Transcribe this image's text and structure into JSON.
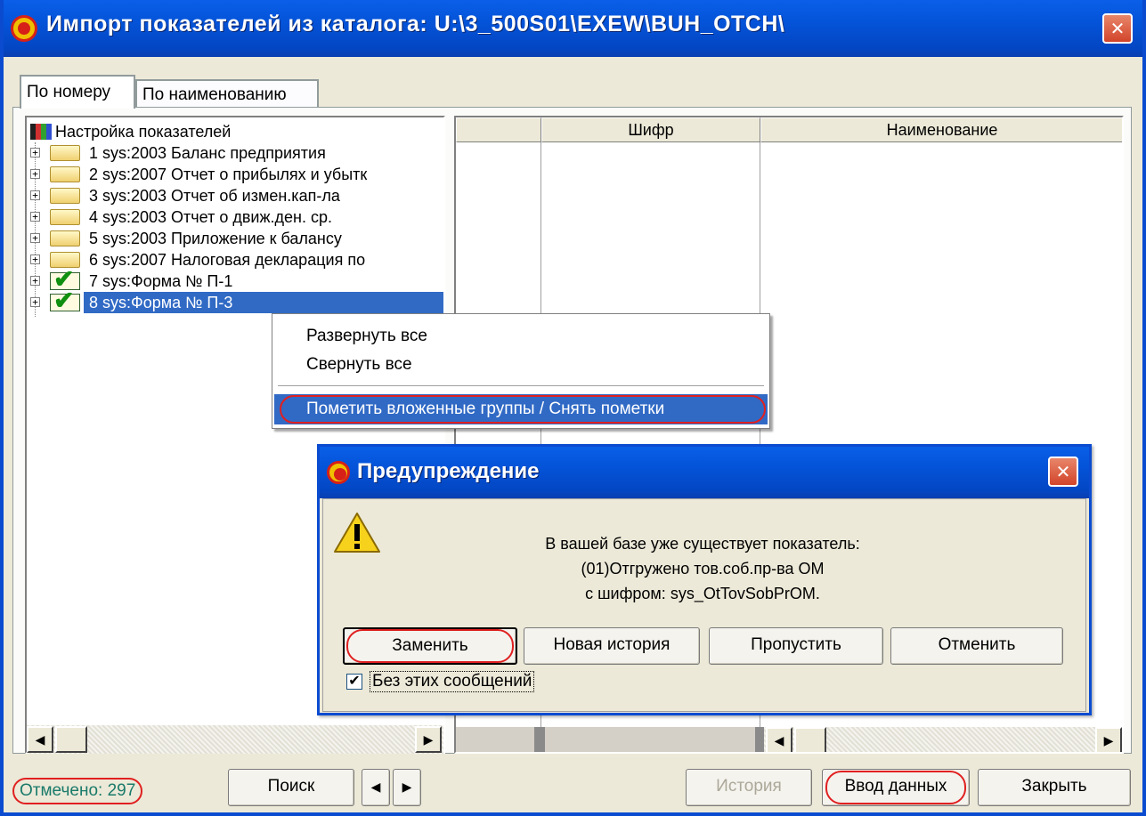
{
  "window": {
    "title": "Импорт показателей из каталога:  U:\\3_500S01\\EXEW\\BUH_OTCH\\",
    "close_label": "✕"
  },
  "tabs": [
    {
      "label": "По номеру",
      "active": true
    },
    {
      "label": "По наименованию",
      "active": false
    }
  ],
  "tree": {
    "root_label": "Настройка показателей",
    "items": [
      {
        "label": "1  sys:2003 Баланс предприятия",
        "icon": "folder-icon"
      },
      {
        "label": "2  sys:2007 Отчет о прибылях и убытк",
        "icon": "folder-icon"
      },
      {
        "label": "3  sys:2003 Отчет об измен.кап-ла",
        "icon": "folder-icon"
      },
      {
        "label": "4  sys:2003 Отчет о движ.ден. ср.",
        "icon": "folder-icon"
      },
      {
        "label": "5  sys:2003 Приложение к балансу",
        "icon": "folder-icon"
      },
      {
        "label": "6  sys:2007 Налоговая декларация по",
        "icon": "folder-icon"
      },
      {
        "label": "7  sys:Форма № П-1",
        "icon": "checkmark-icon"
      },
      {
        "label": "8  sys:Форма № П-3",
        "icon": "checkmark-icon",
        "selected": true
      }
    ]
  },
  "grid": {
    "columns": [
      "",
      "Шифр",
      "Наименование"
    ]
  },
  "context_menu": {
    "items": [
      {
        "label": "Развернуть все"
      },
      {
        "label": "Свернуть все"
      },
      {
        "label": "Пометить вложенные группы / Снять пометки",
        "highlighted": true
      }
    ]
  },
  "dialog": {
    "title": "Предупреждение",
    "close_label": "✕",
    "message_lines": [
      "В вашей базе уже существует показатель:",
      "(01)Отгружено тов.соб.пр-ва ОМ",
      "с шифром: sys_OtTovSobPrOM."
    ],
    "buttons": {
      "replace": "Заменить",
      "new_history": "Новая история",
      "skip": "Пропустить",
      "cancel": "Отменить"
    },
    "checkbox_label": "Без этих сообщений",
    "checkbox_checked": true,
    "checkbox_mark": "✔"
  },
  "footer": {
    "marked": "Отмечено: 297",
    "search": "Поиск",
    "prev": "◀",
    "next": "▶",
    "history": "История",
    "data_entry": "Ввод данных",
    "close": "Закрыть"
  },
  "colors": {
    "titlebar": "#0453d8",
    "selection": "#316ac5",
    "annotation_red": "#e02020",
    "counter_text": "#1a7a6a"
  }
}
